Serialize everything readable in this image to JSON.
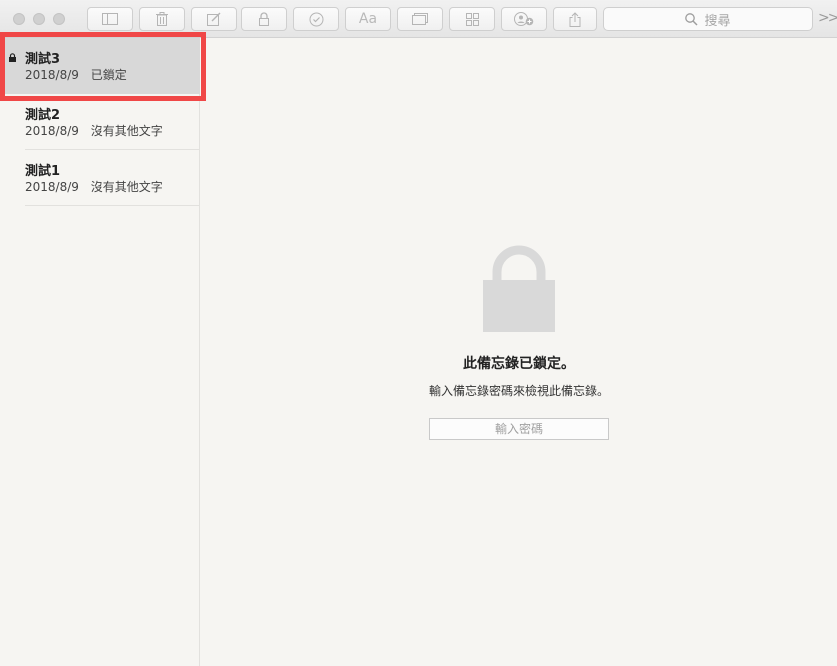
{
  "toolbar": {
    "search_placeholder": "搜尋",
    "format_button_label": "Aa",
    "buttons": [
      "sidebar-toggle",
      "delete",
      "compose",
      "lock",
      "checklist",
      "format",
      "attachment",
      "table",
      "share-contacts",
      "share"
    ]
  },
  "notes": [
    {
      "title": "測試3",
      "date": "2018/8/9",
      "preview": "已鎖定",
      "locked": true,
      "selected": true
    },
    {
      "title": "測試2",
      "date": "2018/8/9",
      "preview": "沒有其他文字",
      "locked": false,
      "selected": false
    },
    {
      "title": "測試1",
      "date": "2018/8/9",
      "preview": "沒有其他文字",
      "locked": false,
      "selected": false
    }
  ],
  "main": {
    "locked_title": "此備忘錄已鎖定。",
    "locked_subtitle": "輸入備忘錄密碼來檢視此備忘錄。",
    "password_placeholder": "輸入密碼"
  },
  "colors": {
    "highlight": "#f04747",
    "selected_row": "#d8d8d8",
    "lock_icon": "#d9d9d9",
    "background": "#f6f5f2"
  }
}
